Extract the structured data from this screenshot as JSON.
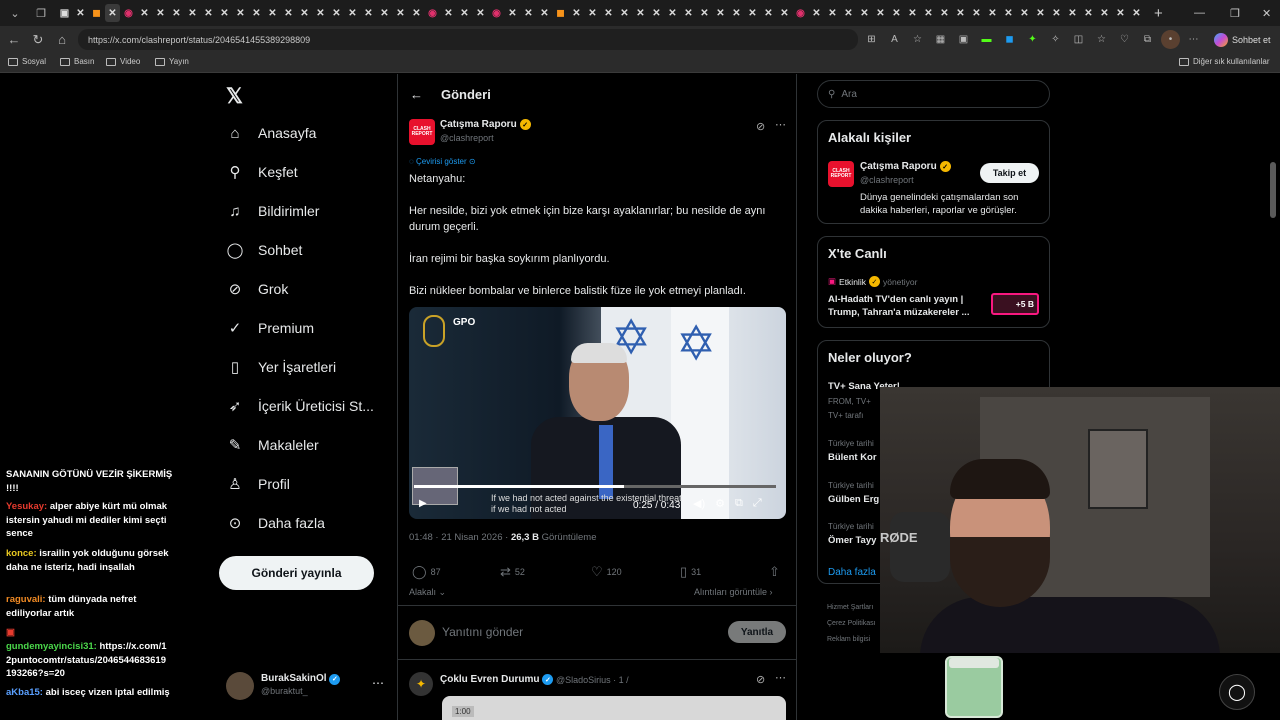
{
  "browser": {
    "url": "https://x.com/clashreport/status/2046541455389298809",
    "copilot_label": "Sohbet et",
    "tab_glyphs": [
      "▣",
      "✕",
      "◼",
      "✕",
      "◉",
      "✕",
      "✕",
      "✕",
      "✕",
      "✕",
      "✕",
      "✕",
      "✕",
      "✕",
      "✕",
      "✕",
      "✕",
      "✕",
      "✕",
      "✕",
      "✕",
      "✕",
      "✕",
      "◉",
      "✕",
      "✕",
      "✕",
      "◉",
      "✕",
      "✕",
      "✕",
      "◼",
      "✕",
      "✕",
      "✕",
      "✕",
      "✕",
      "✕",
      "✕",
      "✕",
      "✕",
      "✕",
      "✕",
      "✕",
      "✕",
      "✕",
      "◉",
      "✕",
      "✕",
      "✕",
      "✕",
      "✕",
      "✕",
      "✕",
      "✕",
      "✕",
      "✕",
      "✕",
      "✕",
      "✕",
      "✕",
      "✕",
      "✕",
      "✕",
      "✕",
      "✕",
      "✕",
      "✕"
    ],
    "bookmarks": [
      "Sosyal",
      "Basın",
      "Video",
      "Yayın"
    ],
    "other_bookmarks": "Diğer sık kullanılanlar"
  },
  "nav": {
    "items": [
      {
        "label": "Anasayfa",
        "icon": "home-icon"
      },
      {
        "label": "Keşfet",
        "icon": "search-icon"
      },
      {
        "label": "Bildirimler",
        "icon": "bell-icon"
      },
      {
        "label": "Sohbet",
        "icon": "chat-icon"
      },
      {
        "label": "Grok",
        "icon": "grok-icon"
      },
      {
        "label": "Premium",
        "icon": "premium-icon"
      },
      {
        "label": "Yer İşaretleri",
        "icon": "bookmark-icon"
      },
      {
        "label": "İçerik Üreticisi St...",
        "icon": "rocket-icon"
      },
      {
        "label": "Makaleler",
        "icon": "article-icon"
      },
      {
        "label": "Profil",
        "icon": "person-icon"
      },
      {
        "label": "Daha fazla",
        "icon": "more-circle-icon"
      }
    ],
    "post_button": "Gönderi yayınla",
    "account": {
      "name": "BurakSakinOl",
      "handle": "@buraktut_"
    }
  },
  "main": {
    "header_title": "Gönderi",
    "post": {
      "author": "Çatışma Raporu",
      "handle": "@clashreport",
      "translate": "Çevirisi göster",
      "paragraphs": [
        "Netanyahu:",
        "Her nesilde, bizi yok etmek için bize karşı ayaklanırlar; bu nesilde de aynı durum geçerli.",
        "İran rejimi bir başka soykırım planlıyordu.",
        "Bizi nükleer bombalar ve binlerce balistik füze ile yok etmeyi planladı."
      ],
      "video": {
        "time": "0:25 / 0:43",
        "progress": 0.58,
        "subtitle_line1": "If we had not acted against the existential threat",
        "subtitle_line2": "if we had not acted",
        "watermark": "GPO"
      },
      "time": "01:48 · 21 Nisan 2026 · ",
      "views": "26,3 B",
      "views_label": " Görüntüleme",
      "replies": "87",
      "reposts": "52",
      "likes": "120",
      "bookmarks": "31",
      "related": "Alakalı",
      "quotes": "Alıntıları görüntüle"
    },
    "reply": {
      "placeholder": "Yanıtını gönder",
      "button": "Yanıtla"
    },
    "next_post": {
      "author": "Çoklu Evren Durumu",
      "handle": "@SladoSirius · 1 /",
      "duration": "1:00"
    }
  },
  "right": {
    "search_placeholder": "Ara",
    "related_title": "Alakalı kişiler",
    "related_person": {
      "name": "Çatışma Raporu",
      "handle": "@clashreport",
      "follow": "Takip et",
      "bio": "Dünya genelindeki çatışmalardan son dakika haberleri, raporlar ve görüşler."
    },
    "live": {
      "title": "X'te Canlı",
      "host": "Etkinlik",
      "host_role": "yönetiyor",
      "headline": "Al-Hadath TV'den canlı yayın | Trump, Tahran'a müzakereler ...",
      "badge": "+5 B"
    },
    "trends": {
      "title": "Neler oluyor?",
      "items": [
        {
          "meta": "",
          "name": "TV+ Sana Yeter!"
        },
        {
          "meta": "FROM, TV+",
          "name": ""
        },
        {
          "meta": "TV+ tarafı",
          "name": ""
        },
        {
          "meta": "Türkiye tarihi",
          "name": "Bülent Kor"
        },
        {
          "meta": "Türkiye tarihi",
          "name": "Gülben Erg"
        },
        {
          "meta": "Türkiye tarihi",
          "name": "Ömer Tayy"
        }
      ],
      "more": "Daha fazla"
    },
    "footer": [
      "Hizmet Şartları",
      "Çerez Politikası",
      "Reklam bilgisi"
    ]
  },
  "chat_overlay": [
    {
      "user": "",
      "text": "SANANIN GÖTÜNÜ VEZİR ŞİKERMİŞ !!!!",
      "color": "u-yel"
    },
    {
      "user": "Yesukay:",
      "text": " alper abiye kürt mü olmak istersin yahudi mi dediler kimi seçti sence",
      "color": "u-red"
    },
    {
      "user": "konce:",
      "text": " israilin yok olduğunu görsek daha ne isteriz, hadi inşallah",
      "color": "u-yel"
    },
    {
      "user": "raguvali:",
      "text": " tüm dünyada nefret ediliyorlar artık",
      "color": "u-org"
    },
    {
      "user": "gundemyayincisi31:",
      "text": " https://x.com/12puntocomtr/status/2046544683619193266?s=20",
      "color": "u-grn"
    },
    {
      "user": "aKba15:",
      "text": " abi isceç vizen iptal edilmiş",
      "color": "u-blu"
    }
  ],
  "webcam": {
    "mic_brand": "RØDE"
  }
}
